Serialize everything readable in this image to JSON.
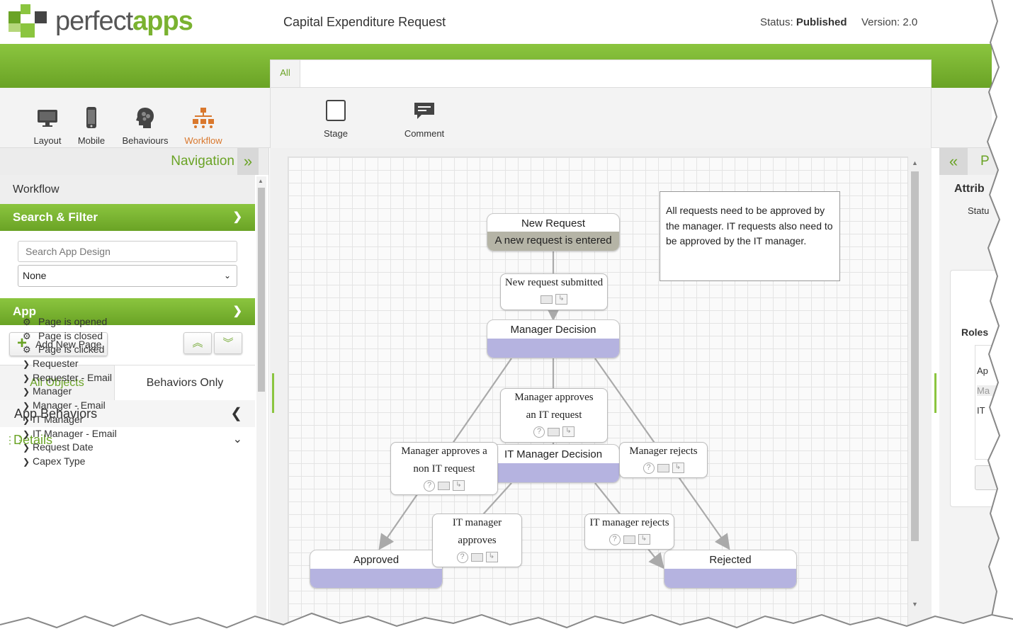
{
  "header": {
    "logo_text_1": "perfect",
    "logo_text_2": "apps",
    "app_title": "Capital Expenditure Request",
    "status_label": "Status:",
    "status_value": "Published",
    "version_label": "Version:",
    "version_value": "2.0"
  },
  "toolbar": {
    "tools": [
      {
        "label": "Layout",
        "icon": "monitor-icon"
      },
      {
        "label": "Mobile",
        "icon": "phone-icon"
      },
      {
        "label": "Behaviours",
        "icon": "brain-icon"
      },
      {
        "label": "Workflow",
        "icon": "org-chart-icon",
        "active": true
      }
    ],
    "tab_all": "All",
    "items": [
      {
        "label": "Stage",
        "icon": "stage-icon"
      },
      {
        "label": "Comment",
        "icon": "comment-icon"
      }
    ]
  },
  "navigation": {
    "title": "Navigation",
    "workflow_row": "Workflow",
    "search_filter_header": "Search & Filter",
    "search_placeholder": "Search App Design",
    "filter_value": "None",
    "app_header": "App",
    "add_page_label": "Add New Page",
    "tabs": [
      "All Objects",
      "Behaviors Only"
    ],
    "app_behaviors": "App Behaviors",
    "details": "Details",
    "tree": [
      {
        "label": "Page is opened",
        "kind": "event"
      },
      {
        "label": "Page is closed",
        "kind": "event"
      },
      {
        "label": "Page is clicked",
        "kind": "event"
      },
      {
        "label": "Requester",
        "kind": "field"
      },
      {
        "label": "Requester - Email",
        "kind": "field"
      },
      {
        "label": "Manager",
        "kind": "field"
      },
      {
        "label": "Manager - Email",
        "kind": "field"
      },
      {
        "label": "IT Manager",
        "kind": "field"
      },
      {
        "label": "IT Manager - Email",
        "kind": "field"
      },
      {
        "label": "Request Date",
        "kind": "field"
      },
      {
        "label": "Capex Type",
        "kind": "field"
      }
    ]
  },
  "workflow": {
    "stages": {
      "new_request": {
        "title": "New Request",
        "body": "A new request is entered"
      },
      "manager_decision": {
        "title": "Manager Decision"
      },
      "it_manager_decision": {
        "title": "IT Manager Decision"
      },
      "approved": {
        "title": "Approved"
      },
      "rejected": {
        "title": "Rejected"
      }
    },
    "transitions": {
      "submitted": "New request  submitted",
      "mgr_approves_it_1": "Manager approves",
      "mgr_approves_it_2": "an IT request",
      "mgr_approves_non_it_1": "Manager approves a",
      "mgr_approves_non_it_2": "non IT request",
      "mgr_rejects": "Manager  rejects",
      "it_approves_1": "IT manager",
      "it_approves_2": "approves",
      "it_rejects": "IT manager  rejects"
    },
    "comment": "All requests need to be approved by the manager. IT requests also need to be approved by the IT manager."
  },
  "right_panel": {
    "title_partial": "P",
    "attrib_partial": "Attrib",
    "status_partial": "Statu",
    "roles_partial": "Roles",
    "roles_items": [
      "Ap",
      "Ma",
      "IT"
    ]
  }
}
